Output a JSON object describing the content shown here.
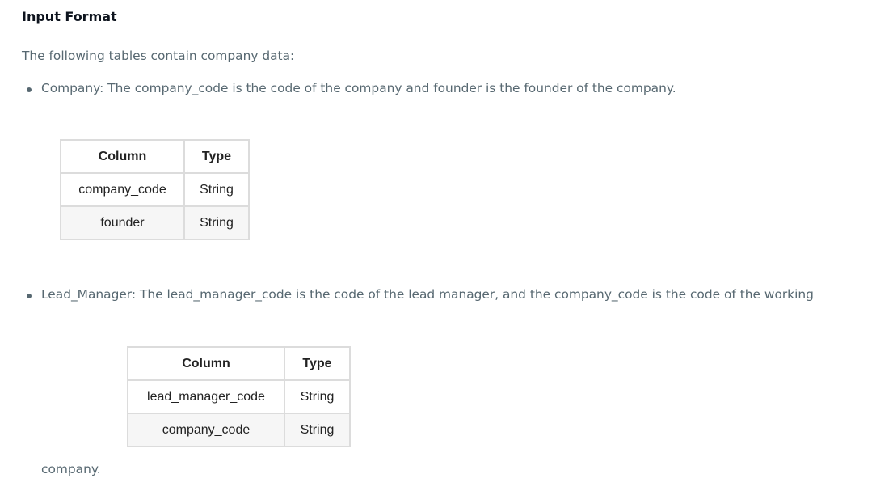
{
  "heading": "Input Format",
  "intro": "The following tables contain company data:",
  "bullets": [
    "Company: The company_code is the code of the company and founder is the founder of the company.",
    "Lead_Manager: The lead_manager_code is the code of the lead manager, and the company_code is the code of the working"
  ],
  "continuation": "company.",
  "tables": [
    {
      "headers": [
        "Column",
        "Type"
      ],
      "rows": [
        [
          "company_code",
          "String"
        ],
        [
          "founder",
          "String"
        ]
      ]
    },
    {
      "headers": [
        "Column",
        "Type"
      ],
      "rows": [
        [
          "lead_manager_code",
          "String"
        ],
        [
          "company_code",
          "String"
        ]
      ]
    }
  ]
}
